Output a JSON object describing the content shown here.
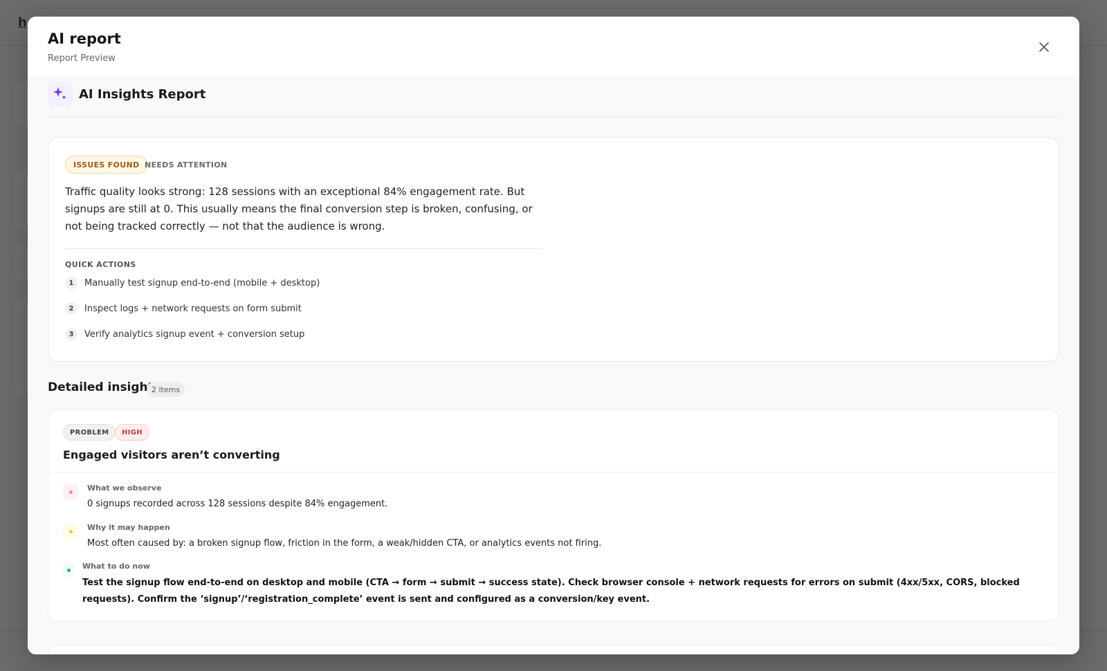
{
  "background": {
    "logo": "h"
  },
  "modal": {
    "title": "AI report",
    "subtitle": "Report Preview"
  },
  "report": {
    "title": "AI Insights Report"
  },
  "summary": {
    "status_badge": "ISSUES FOUND",
    "status_note": "NEEDS ATTENTION",
    "text": "Traffic quality looks strong: 128 sessions with an exceptional 84% engagement rate. But signups are still at 0. This usually means the final conversion step is broken, confusing, or not being tracked correctly — not that the audience is wrong.",
    "quick_actions_heading": "QUICK ACTIONS",
    "quick_actions": [
      {
        "num": "1",
        "text": "Manually test signup end-to-end (mobile + desktop)"
      },
      {
        "num": "2",
        "text": "Inspect logs + network requests on form submit"
      },
      {
        "num": "3",
        "text": "Verify analytics signup event + conversion setup"
      }
    ]
  },
  "details": {
    "heading": "Detailed insights",
    "count": "2 items",
    "insights": [
      {
        "type_tag": "PROBLEM",
        "severity_tag": "HIGH",
        "title": "Engaged visitors aren’t converting",
        "observe_label": "What we observe",
        "observe_text": "0 signups recorded across 128 sessions despite 84% engagement.",
        "why_label": "Why it may happen",
        "why_text": "Most often caused by: a broken signup flow, friction in the form, a weak/hidden CTA, or analytics events not firing.",
        "todo_label": "What to do now",
        "todo_text": "Test the signup flow end-to-end on desktop and mobile (CTA → form → submit → success state). Check browser console + network requests for errors on submit (4xx/5xx, CORS, blocked requests). Confirm the ‘signup’/‘registration_complete’ event is sent and configured as a conversion/key event."
      }
    ]
  },
  "colors": {
    "accent_purple": "#7c3aed",
    "observe_dot": "#f08a9a",
    "why_dot": "#f5c518",
    "todo_dot": "#22b573"
  }
}
